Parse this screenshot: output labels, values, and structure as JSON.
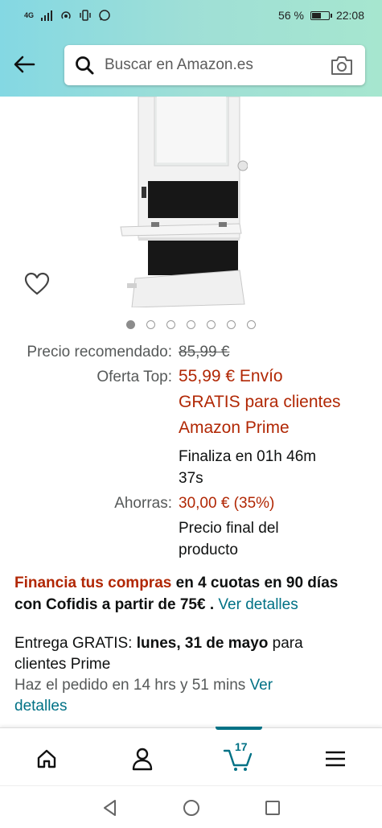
{
  "status_bar": {
    "network_label": "4G",
    "battery_percent_text": "56 %",
    "battery_level": 0.56,
    "time": "22:08"
  },
  "search": {
    "placeholder": "Buscar en Amazon.es"
  },
  "icons": {
    "back": "arrow-left-icon",
    "search": "search-icon",
    "camera": "camera-icon",
    "wishlist": "heart-icon",
    "home": "home-icon",
    "account": "person-icon",
    "cart": "cart-icon",
    "menu": "hamburger-icon"
  },
  "carousel": {
    "total_images": 7,
    "active_index": 0
  },
  "pricing": {
    "list_price_label": "Precio recomendado:",
    "list_price": "85,99 €",
    "deal_label": "Oferta Top:",
    "deal_line1": "55,99 € Envío",
    "deal_line2": "GRATIS para clientes",
    "deal_line3": "Amazon Prime",
    "ends_line1": "Finaliza en 01h 46m",
    "ends_line2": "37s",
    "savings_label": "Ahorras:",
    "savings_value": "30,00 € (35%)",
    "final_line1": "Precio final del",
    "final_line2": "producto"
  },
  "financing": {
    "highlight": "Financia tus compras",
    "text_line1": " en 4 cuotas en 90 días",
    "text_line2": "con Cofidis a partir de 75€",
    "separator": " . ",
    "link": "Ver detalles"
  },
  "delivery": {
    "prefix": "Entrega GRATIS: ",
    "date": "lunes, 31 de mayo",
    "suffix": " para",
    "line2": "clientes Prime",
    "order_text": "Haz el pedido en 14 hrs y 51 mins ",
    "link_part1": "Ver",
    "link_part2": "detalles"
  },
  "bottom_nav": {
    "cart_count": "17"
  },
  "colors": {
    "accent_link": "#007185",
    "price_red": "#b12704",
    "header_gradient_start": "#84d8e3",
    "header_gradient_end": "#a6e6cf"
  }
}
